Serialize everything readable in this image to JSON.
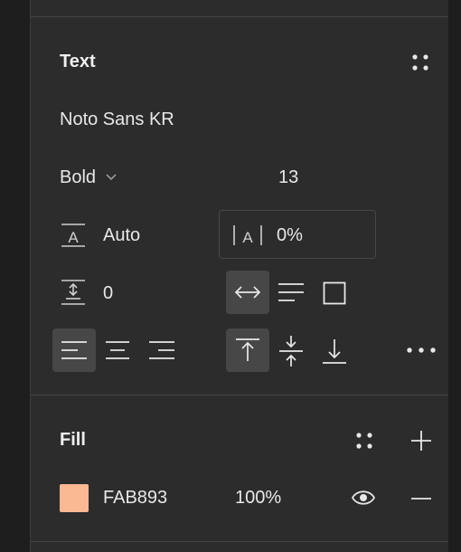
{
  "text_section": {
    "title": "Text",
    "font_family": "Noto Sans KR",
    "font_weight": "Bold",
    "font_size": "13",
    "line_height": "Auto",
    "letter_spacing": "0%",
    "paragraph_spacing": "0"
  },
  "fill_section": {
    "title": "Fill",
    "color_hex": "FAB893",
    "swatch_color": "#fab893",
    "opacity": "100%"
  },
  "icons": {
    "text_styles": "grid-dots-icon",
    "fill_styles": "grid-dots-icon",
    "weight_dropdown": "chevron-down-icon",
    "line_height": "line-height-icon",
    "letter_spacing": "letter-spacing-icon",
    "paragraph_spacing": "paragraph-spacing-icon",
    "auto_width": "auto-width-icon",
    "auto_height": "auto-height-icon",
    "fixed_size": "fixed-size-icon",
    "align_left": "align-left-icon",
    "align_center": "align-center-icon",
    "align_right": "align-right-icon",
    "align_top": "align-top-icon",
    "align_middle": "align-middle-icon",
    "align_bottom": "align-bottom-icon",
    "more": "more-icon",
    "add_fill": "plus-icon",
    "visibility": "eye-icon",
    "remove_fill": "minus-icon"
  },
  "state": {
    "active_resize": "auto-width",
    "active_horizontal_align": "left",
    "active_vertical_align": "top"
  }
}
